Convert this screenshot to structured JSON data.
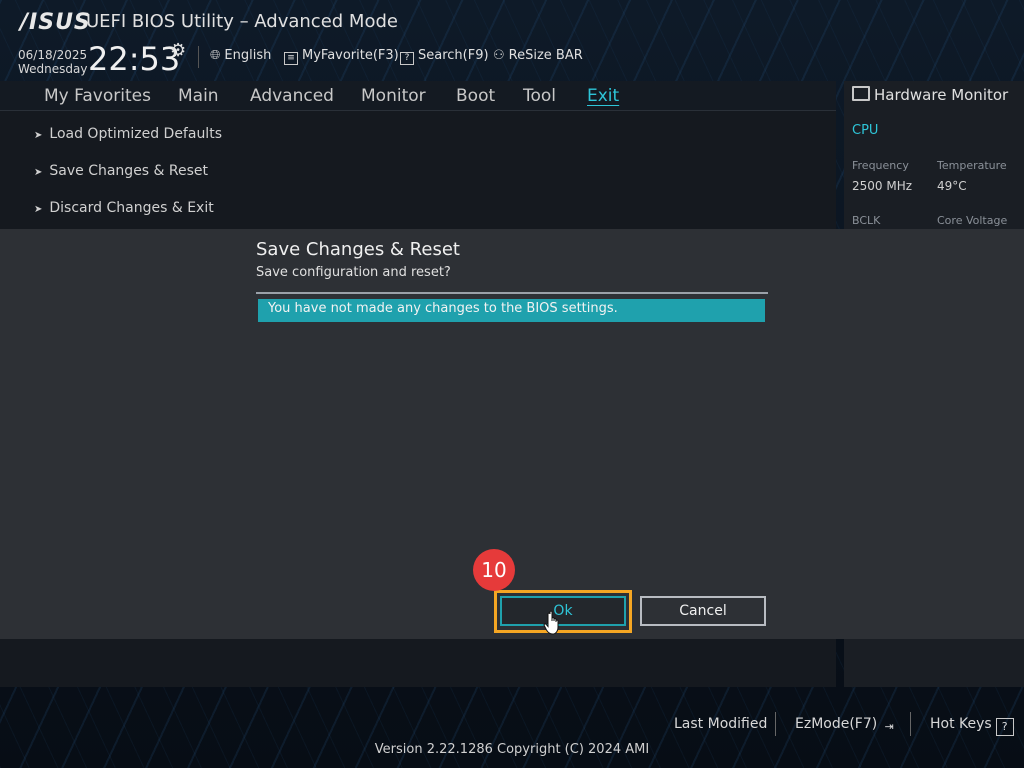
{
  "header": {
    "logo": "/ISUS",
    "title": "UEFI BIOS Utility – Advanced Mode",
    "date": "06/18/2025",
    "weekday": "Wednesday",
    "time": "22:53",
    "language": "English",
    "myfavorite": "MyFavorite(F3)",
    "search": "Search(F9)",
    "resize_bar": "ReSize BAR"
  },
  "nav": {
    "tabs": [
      "My Favorites",
      "Main",
      "Advanced",
      "Monitor",
      "Boot",
      "Tool",
      "Exit"
    ],
    "active": "Exit"
  },
  "menu": {
    "items": [
      "Load Optimized Defaults",
      "Save Changes & Reset",
      "Discard Changes & Exit"
    ]
  },
  "hardware_monitor": {
    "title": "Hardware Monitor",
    "section": "CPU",
    "frequency_label": "Frequency",
    "frequency_value": "2500 MHz",
    "temperature_label": "Temperature",
    "temperature_value": "49°C",
    "bclk_label": "BCLK",
    "core_voltage_label": "Core Voltage"
  },
  "dialog": {
    "title": "Save Changes & Reset",
    "subtitle": "Save configuration and reset?",
    "message": "You have not made any changes to the BIOS settings.",
    "ok_label": "Ok",
    "cancel_label": "Cancel",
    "step_number": "10"
  },
  "footer": {
    "last_modified": "Last Modified",
    "ezmode": "EzMode(F7)",
    "hot_keys": "Hot Keys",
    "version": "Version 2.22.1286 Copyright (C) 2024 AMI"
  },
  "colors": {
    "accent": "#2ec5d8",
    "message_bar": "#1fa1ad",
    "highlight": "#f5a623",
    "step_badge": "#e63a3a"
  }
}
